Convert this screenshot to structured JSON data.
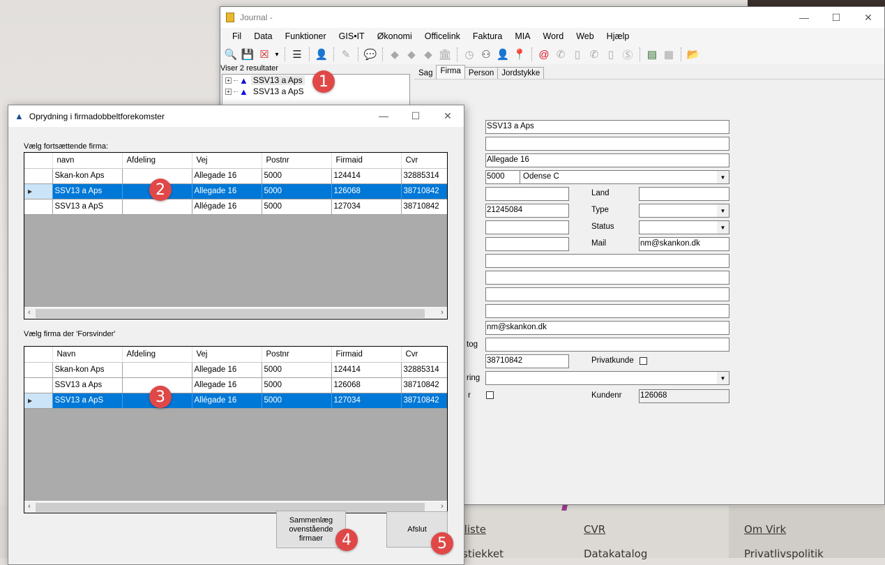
{
  "background_page": {
    "links": [
      {
        "text": "kliste",
        "underline": true
      },
      {
        "text": "CVR",
        "underline": true
      },
      {
        "text": "Om Virk",
        "underline": true
      },
      {
        "text": "stiekket",
        "underline": false
      },
      {
        "text": "Datakatalog",
        "underline": false
      },
      {
        "text": "Privatlivspolitik",
        "underline": false
      }
    ]
  },
  "journal": {
    "title": "Journal -",
    "window_controls": {
      "minimize": "—",
      "maximize": "☐",
      "close": "✕"
    },
    "menu": [
      "Fil",
      "Data",
      "Funktioner",
      "GIS•IT",
      "Økonomi",
      "Officelink",
      "Faktura",
      "MIA",
      "Word",
      "Web",
      "Hjælp"
    ],
    "toolbar_icons": [
      {
        "name": "search-icon",
        "glyph": "🔍",
        "enabled": true
      },
      {
        "name": "save-icon",
        "glyph": "💾",
        "enabled": true
      },
      {
        "name": "delete-list-icon",
        "glyph": "☒",
        "enabled": true
      },
      {
        "name": "dropdown-arrow-icon",
        "glyph": "▾",
        "enabled": true
      },
      {
        "name": "list-icon",
        "glyph": "☰",
        "enabled": true
      },
      {
        "name": "person-icon",
        "glyph": "👤",
        "enabled": true
      },
      {
        "name": "map-edit-icon",
        "glyph": "✎",
        "enabled": false
      },
      {
        "name": "chat-icon",
        "glyph": "💬",
        "enabled": false
      },
      {
        "name": "tag-icon",
        "glyph": "◆",
        "enabled": false
      },
      {
        "name": "tag-number-icon",
        "glyph": "◆",
        "enabled": false
      },
      {
        "name": "tag-alt-icon",
        "glyph": "◆",
        "enabled": false
      },
      {
        "name": "bank-icon",
        "glyph": "🏛",
        "enabled": false
      },
      {
        "name": "clock-icon",
        "glyph": "◷",
        "enabled": false
      },
      {
        "name": "binoculars-icon",
        "glyph": "⚇",
        "enabled": true
      },
      {
        "name": "person-search-icon",
        "glyph": "👤",
        "enabled": true
      },
      {
        "name": "location-pin-icon",
        "glyph": "📍",
        "enabled": true
      },
      {
        "name": "email-icon",
        "glyph": "@",
        "enabled": true
      },
      {
        "name": "phone-icon",
        "glyph": "✆",
        "enabled": false
      },
      {
        "name": "mobile-icon",
        "glyph": "▯",
        "enabled": false
      },
      {
        "name": "phone-alt-icon",
        "glyph": "✆",
        "enabled": false
      },
      {
        "name": "mobile-alt-icon",
        "glyph": "▯",
        "enabled": false
      },
      {
        "name": "skype-icon",
        "glyph": "Ⓢ",
        "enabled": false
      },
      {
        "name": "contact-card-icon",
        "glyph": "▤",
        "enabled": true
      },
      {
        "name": "calendar-icon",
        "glyph": "▦",
        "enabled": false
      },
      {
        "name": "folder-binoculars-icon",
        "glyph": "📂",
        "enabled": true
      }
    ],
    "results_label": "Viser 2 resultater",
    "tree_items": [
      {
        "label": "SSV13 a Aps",
        "selected": true
      },
      {
        "label": "SSV13 a ApS",
        "selected": false
      }
    ],
    "tabs": [
      {
        "label": "Sag",
        "active": false
      },
      {
        "label": "Firma",
        "active": true
      },
      {
        "label": "Person",
        "active": false
      },
      {
        "label": "Jordstykke",
        "active": false
      }
    ],
    "form": {
      "name": "SSV13 a Aps",
      "name2": "",
      "address": "Allegade 16",
      "postnr": "5000",
      "city": "Odense C",
      "field_left_1": "",
      "phone": "21245084",
      "field_left_3": "",
      "field_left_4": "",
      "land_label": "Land",
      "land": "",
      "type_label": "Type",
      "type": "",
      "status_label": "Status",
      "status": "",
      "mail_label": "Mail",
      "mail": "nm@skankon.dk",
      "wide_1": "",
      "wide_2": "",
      "wide_3": "",
      "wide_4": "",
      "email2": "nm@skankon.dk",
      "katalog_label_partial": "tog",
      "katalog": "",
      "cvr": "38710842",
      "privatkunde_label": "Privatkunde",
      "privatkunde_checked": false,
      "ring_label_partial": "ring",
      "ring": "",
      "r_label_partial": "r",
      "r_checked": false,
      "kundenr_label": "Kundenr",
      "kundenr": "126068"
    }
  },
  "dialog": {
    "title": "Oprydning i firmadobbeltforekomster",
    "window_controls": {
      "minimize": "—",
      "maximize": "☐",
      "close": "✕"
    },
    "grid1": {
      "label": "Vælg fortsættende firma:",
      "columns": [
        "navn",
        "Afdeling",
        "Vej",
        "Postnr",
        "Firmaid",
        "Cvr"
      ],
      "rows": [
        {
          "cells": [
            "Skan-kon Aps",
            "",
            "Allegade 16",
            "5000",
            "124414",
            "32885314"
          ],
          "selected": false
        },
        {
          "cells": [
            "SSV13 a Aps",
            "",
            "Allegade 16",
            "5000",
            "126068",
            "38710842"
          ],
          "selected": true
        },
        {
          "cells": [
            "SSV13 a ApS",
            "",
            "Allégade 16",
            "5000",
            "127034",
            "38710842"
          ],
          "selected": false
        }
      ]
    },
    "grid2": {
      "label": "Vælg firma der 'Forsvinder'",
      "columns": [
        "Navn",
        "Afdeling",
        "Vej",
        "Postnr",
        "Firmaid",
        "Cvr"
      ],
      "rows": [
        {
          "cells": [
            "Skan-kon Aps",
            "",
            "Allegade 16",
            "5000",
            "124414",
            "32885314"
          ],
          "selected": false
        },
        {
          "cells": [
            "SSV13 a Aps",
            "",
            "Allegade 16",
            "5000",
            "126068",
            "38710842"
          ],
          "selected": false
        },
        {
          "cells": [
            "SSV13 a ApS",
            "",
            "Allégade 16",
            "5000",
            "127034",
            "38710842"
          ],
          "selected": true
        }
      ]
    },
    "merge_button": "Sammenlæg ovenstående firmaer",
    "close_button": "Afslut"
  },
  "annotations": [
    "1",
    "2",
    "3",
    "4",
    "5"
  ],
  "colors": {
    "selection": "#0078d7",
    "badge": "#e04848",
    "grid_background": "#ababab"
  }
}
